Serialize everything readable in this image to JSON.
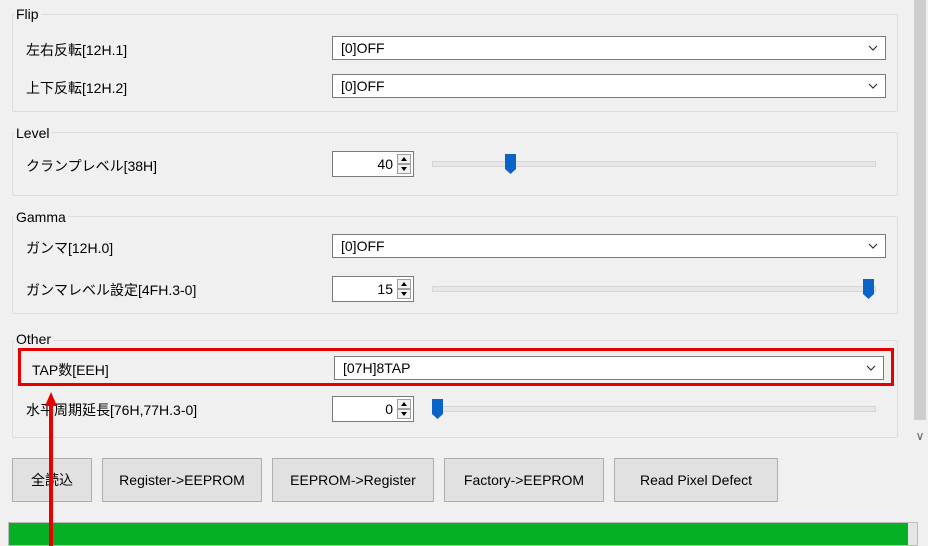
{
  "groups": {
    "flip": {
      "title": "Flip",
      "rows": [
        {
          "label": "左右反転[12H.1]",
          "value": "[0]OFF"
        },
        {
          "label": "上下反転[12H.2]",
          "value": "[0]OFF"
        }
      ]
    },
    "level": {
      "title": "Level",
      "rows": [
        {
          "label": "クランプレベル[38H]",
          "value": "40"
        }
      ]
    },
    "gamma": {
      "title": "Gamma",
      "rows": [
        {
          "label": "ガンマ[12H.0]",
          "value": "[0]OFF"
        },
        {
          "label": "ガンマレベル設定[4FH.3-0]",
          "value": "15"
        }
      ]
    },
    "other": {
      "title": "Other",
      "rows": [
        {
          "label": "TAP数[EEH]",
          "value": "[07H]8TAP"
        },
        {
          "label": "水平周期延長[76H,77H.3-0]",
          "value": "0"
        }
      ]
    }
  },
  "sliders": {
    "clamp_level": 0.17,
    "gamma_level": 1.0,
    "horizontal_extension": 0.0
  },
  "buttons": {
    "read_all": "全読込",
    "register_to_eeprom": "Register->EEPROM",
    "eeprom_to_register": "EEPROM->Register",
    "factory_to_eeprom": "Factory->EEPROM",
    "read_pixel_defect": "Read Pixel Defect"
  },
  "progress": {
    "fraction": 0.99
  },
  "colors": {
    "accent": "#0a64c8",
    "progress": "#06b025",
    "highlight": "#e60000"
  },
  "icons": {
    "dropdown": "chevron-down-icon",
    "spin": "spin-up-down-icon",
    "scroll": "chevron-down-icon"
  }
}
